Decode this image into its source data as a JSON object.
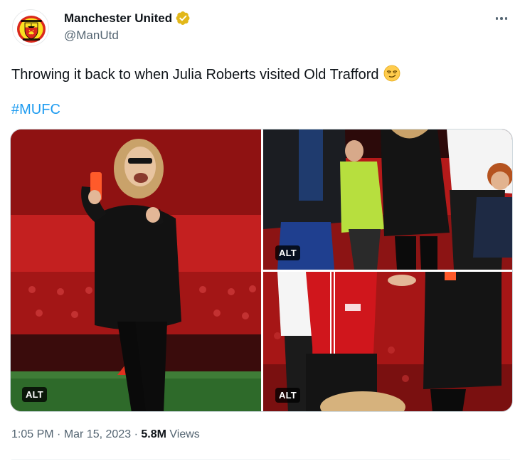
{
  "account": {
    "display_name": "Manchester United",
    "handle": "@ManUtd",
    "verified": true,
    "avatar_icon": "manutd-crest-icon"
  },
  "tweet": {
    "text": "Throwing it back to when Julia Roberts visited Old Trafford",
    "emoji": "smirking-face-emoji",
    "hashtag": "#MUFC"
  },
  "media": {
    "photos": [
      {
        "alt_label": "ALT"
      },
      {
        "alt_label": "ALT"
      },
      {
        "alt_label": "ALT"
      }
    ]
  },
  "meta": {
    "time": "1:05 PM",
    "separator": "·",
    "date": "Mar 15, 2023",
    "views_count": "5.8M",
    "views_label": "Views"
  },
  "colors": {
    "link": "#1d9bf0",
    "secondary_text": "#536471",
    "verified_gold": "#e2b719",
    "united_red": "#da291c"
  }
}
